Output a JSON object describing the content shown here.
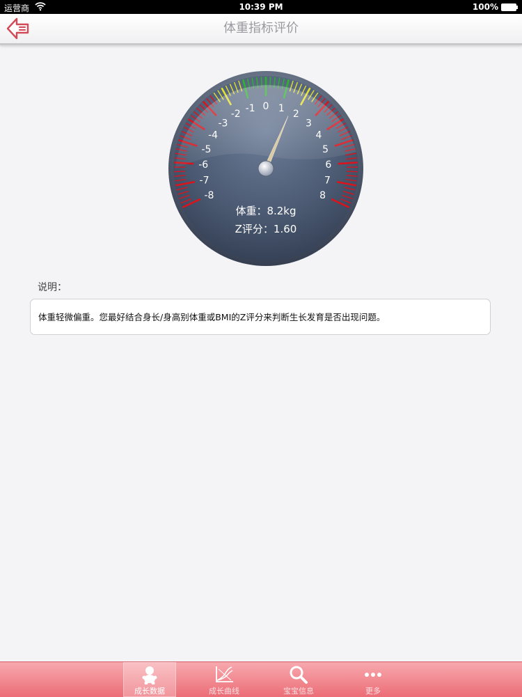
{
  "status_bar": {
    "carrier": "运营商",
    "time": "10:39 PM",
    "battery": "100%"
  },
  "nav": {
    "title": "体重指标评价",
    "back_icon": "back-arrow-icon"
  },
  "gauge": {
    "ticks_left": [
      "-8",
      "-7",
      "-6",
      "-5",
      "-4",
      "-3",
      "-2",
      "-1"
    ],
    "tick_zero": "0",
    "ticks_right": [
      "1",
      "2",
      "3",
      "4",
      "5",
      "6",
      "7",
      "8"
    ],
    "range": [
      -8,
      8
    ],
    "needle_value": 1.6,
    "weight_text": "体重：8.2kg",
    "z_text": "Z评分：1.60",
    "colors": {
      "good": "#2fb32f",
      "warn": "#e4e030",
      "bad": "#d9141c",
      "face": "#4b5a72"
    }
  },
  "description": {
    "label": "说明：",
    "text": "体重轻微偏重。您最好结合身长/身高别体重或BMI的Z评分来判断生长发育是否出现问题。"
  },
  "tabs": [
    {
      "label": "成长数据",
      "icon": "baby-icon",
      "active": true
    },
    {
      "label": "成长曲线",
      "icon": "growth-chart-icon",
      "active": false
    },
    {
      "label": "宝宝信息",
      "icon": "search-icon",
      "active": false
    },
    {
      "label": "更多",
      "icon": "more-dots-icon",
      "active": false
    }
  ]
}
